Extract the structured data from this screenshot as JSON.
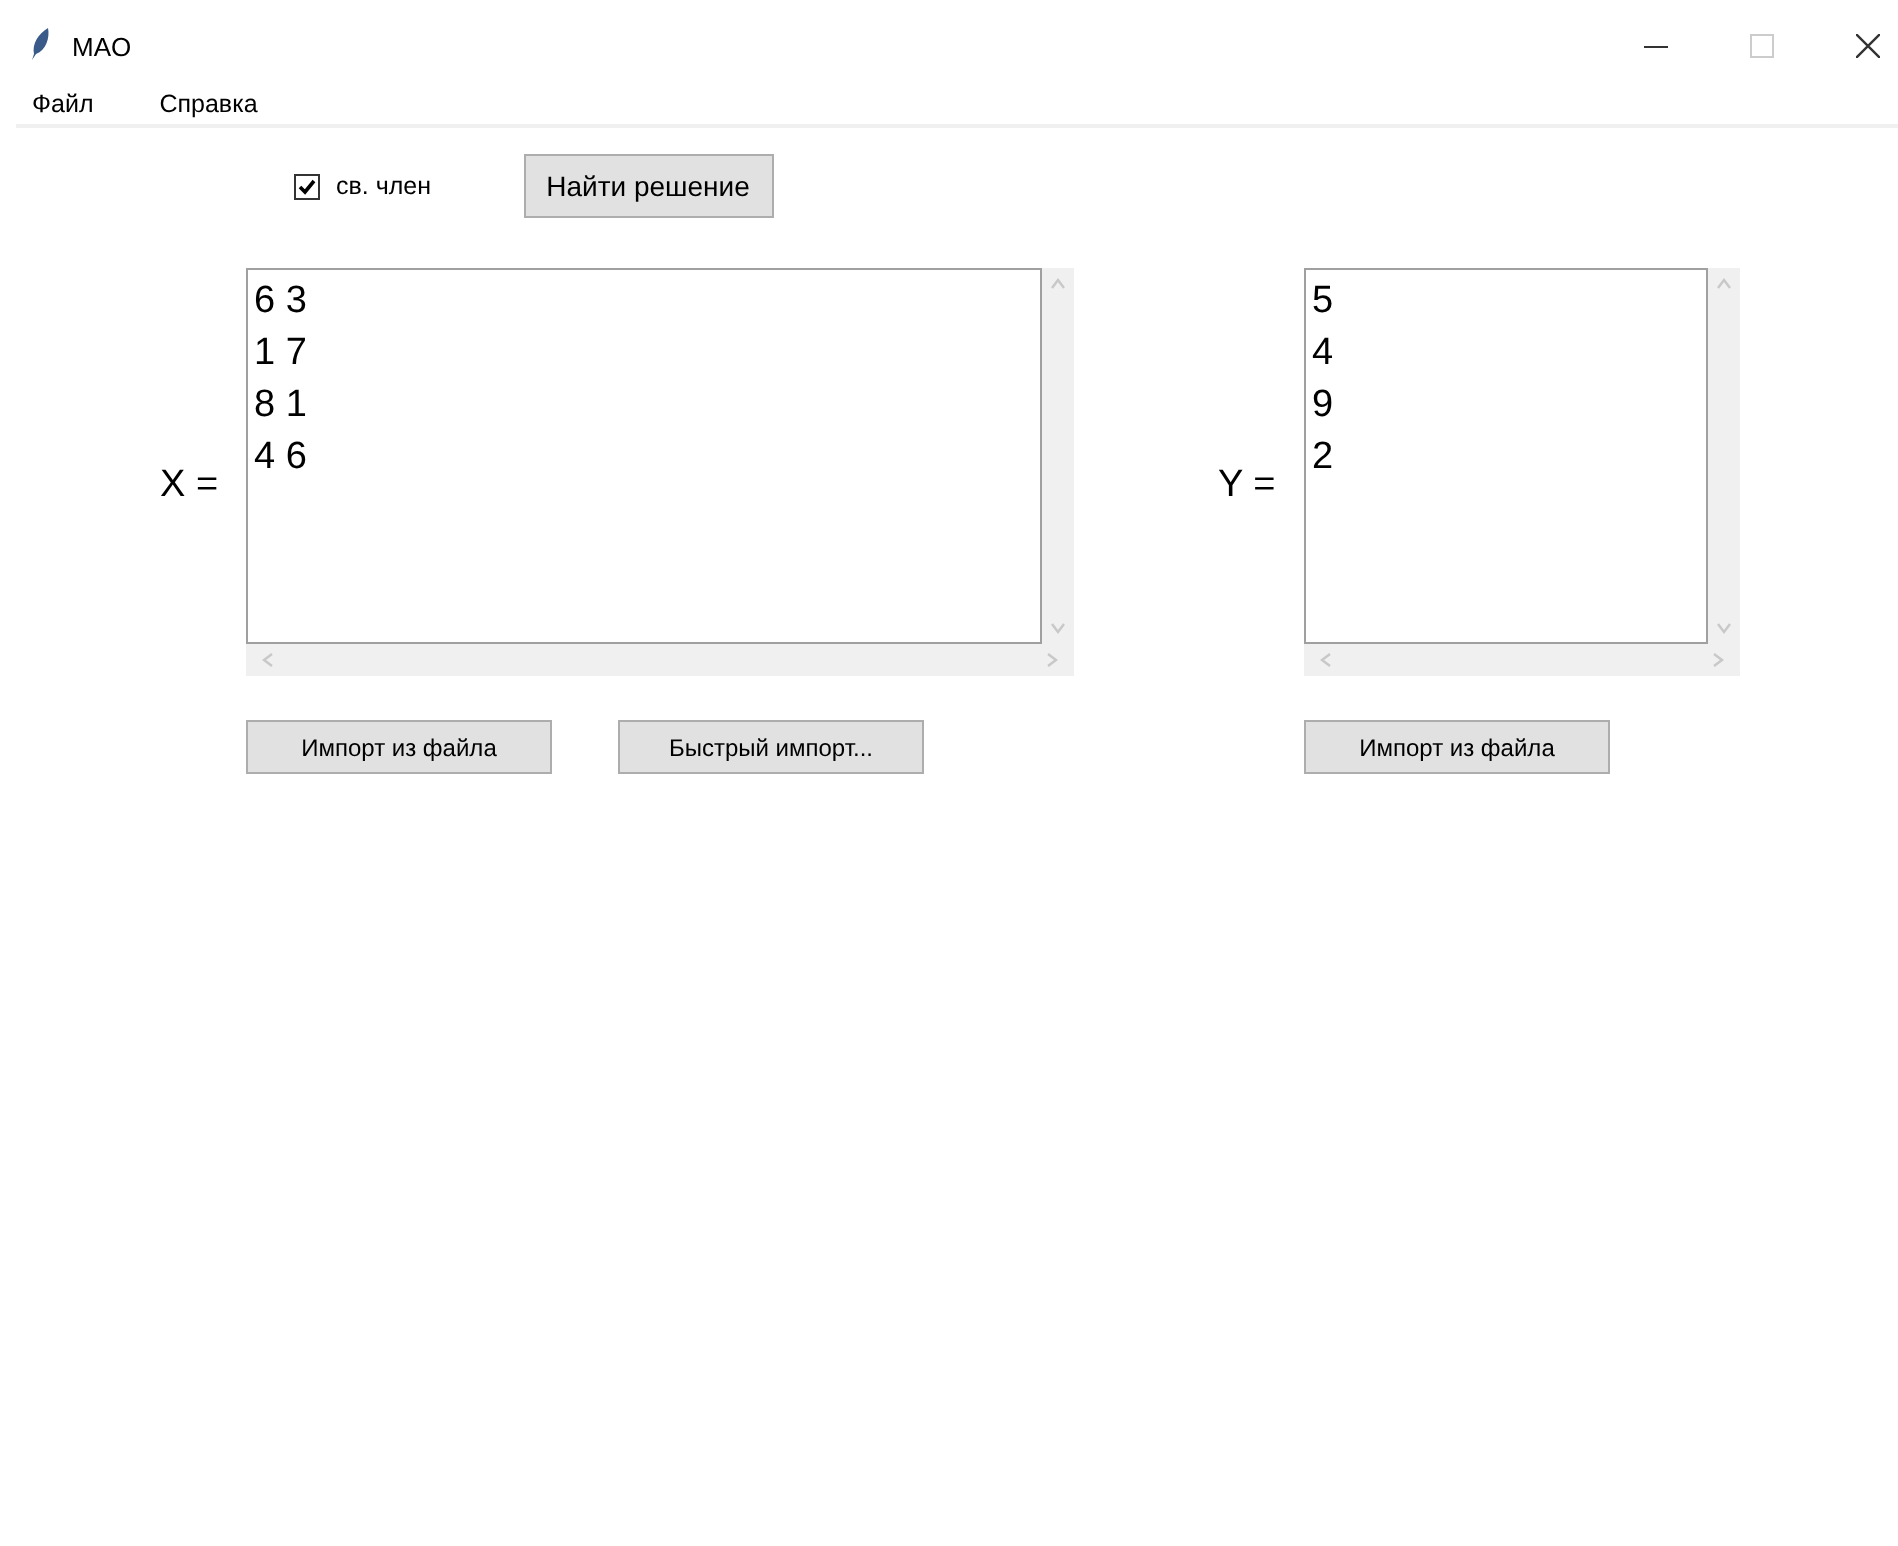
{
  "window": {
    "title": "MAO"
  },
  "menu": [
    "Файл",
    "Справка"
  ],
  "intercept": {
    "label": "св. член",
    "checked": true
  },
  "solve_button": "Найти решение",
  "editors": [
    {
      "label": "X =",
      "lines": [
        "6 3",
        "1 7",
        "8 1",
        "4 6"
      ],
      "buttons": [
        "Импорт из файла",
        "Быстрый импорт..."
      ]
    },
    {
      "label": "Y =",
      "lines": [
        "5",
        "4",
        "9",
        "2"
      ],
      "buttons": [
        "Импорт из файла"
      ]
    }
  ]
}
